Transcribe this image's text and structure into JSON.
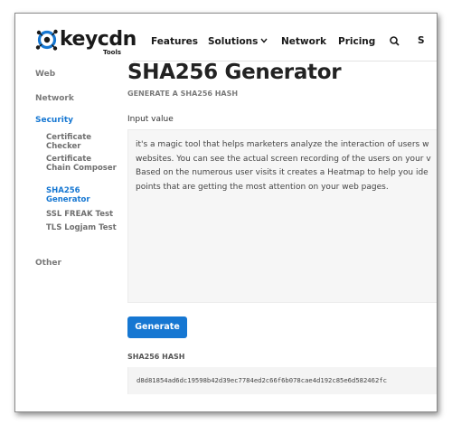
{
  "header": {
    "logo_text": "keycdn",
    "logo_sub": "Tools",
    "nav": {
      "features": "Features",
      "solutions": "Solutions",
      "network": "Network",
      "pricing": "Pricing",
      "cut_item": "S"
    }
  },
  "sidebar": {
    "web": "Web",
    "network": "Network",
    "security": "Security",
    "security_items": [
      {
        "label": "Certificate Checker",
        "active": false
      },
      {
        "label": "Certificate Chain Composer",
        "active": false
      },
      {
        "label": "SHA256 Generator",
        "active": true
      },
      {
        "label": "SSL FREAK Test",
        "active": false
      },
      {
        "label": "TLS Logjam Test",
        "active": false
      }
    ],
    "other": "Other"
  },
  "main": {
    "title": "SHA256 Generator",
    "subtitle": "GENERATE A SHA256 HASH",
    "input_label": "Input value",
    "input_value": "it's a magic tool that helps marketers analyze the interaction of users w\nwebsites. You can see the actual screen recording of the users on your v\nBased on the numerous user visits it creates a Heatmap to help you ide\npoints that are getting the most attention on your web pages.",
    "generate_label": "Generate",
    "hash_label": "SHA256 HASH",
    "hash_value": "d8d81854ad6dc19598b42d39ec7784ed2c66f6b078cae4d192c85e6d582462fc"
  },
  "colors": {
    "accent": "#1677d2",
    "text_dark": "#222222",
    "text_muted": "#7a7a7a",
    "field_bg": "#f6f6f6"
  }
}
